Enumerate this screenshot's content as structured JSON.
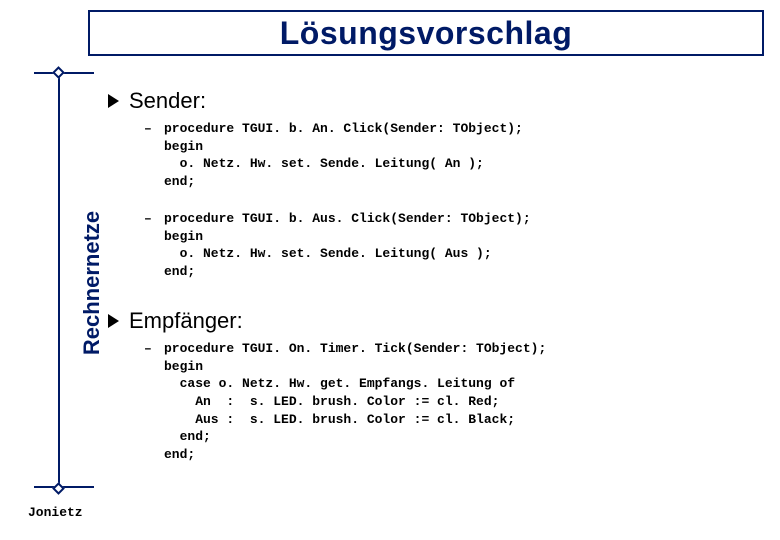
{
  "sidebar_label": "Rechnernetze",
  "title": "Lösungsvorschlag",
  "sections": {
    "sender": {
      "label": "Sender:",
      "code1": "procedure TGUI. b. An. Click(Sender: TObject);\nbegin\n  o. Netz. Hw. set. Sende. Leitung( An );\nend;",
      "code2": "procedure TGUI. b. Aus. Click(Sender: TObject);\nbegin\n  o. Netz. Hw. set. Sende. Leitung( Aus );\nend;"
    },
    "empfaenger": {
      "label": "Empfänger:",
      "code1": "procedure TGUI. On. Timer. Tick(Sender: TObject);\nbegin\n  case o. Netz. Hw. get. Empfangs. Leitung of\n    An  :  s. LED. brush. Color := cl. Red;\n    Aus :  s. LED. brush. Color := cl. Black;\n  end;\nend;"
    }
  },
  "dash": "–",
  "footer": "Jonietz"
}
